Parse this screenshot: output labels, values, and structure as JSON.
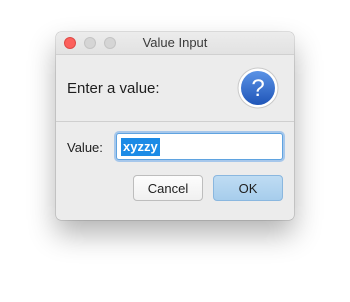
{
  "window": {
    "title": "Value Input"
  },
  "prompt": {
    "text": "Enter a value:",
    "icon": "question-icon"
  },
  "field": {
    "label": "Value:",
    "value": "xyzzy"
  },
  "buttons": {
    "cancel": "Cancel",
    "ok": "OK"
  },
  "colors": {
    "close_button": "#fc605c",
    "inactive_button": "#d5d5d5",
    "icon_blue": "#2f6ad0",
    "selection": "#1c8be6",
    "default_button": "#a7cdec"
  }
}
